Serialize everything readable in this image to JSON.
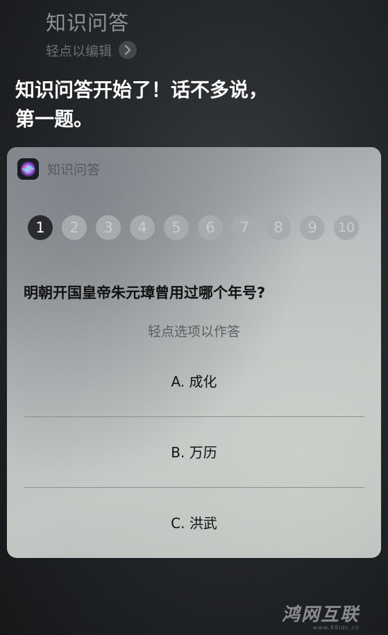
{
  "siri": {
    "query": "知识问答",
    "edit_label": "轻点以编辑",
    "response": [
      "知识问答开始了！话不多说，",
      "第一题。"
    ]
  },
  "card": {
    "app_title": "知识问答",
    "progress": {
      "current": 1,
      "steps": [
        "1",
        "2",
        "3",
        "4",
        "5",
        "6",
        "7",
        "8",
        "9",
        "10"
      ]
    },
    "question": "明朝开国皇帝朱元璋曾用过哪个年号?",
    "hint": "轻点选项以作答",
    "options": [
      "A. 成化",
      "B. 万历",
      "C. 洪武"
    ]
  },
  "watermark": {
    "logo": "鸿网互联",
    "url": "www.68idc.cn"
  },
  "icons": {
    "chevron": "chevron-right-icon",
    "siri": "siri-orb-icon"
  }
}
